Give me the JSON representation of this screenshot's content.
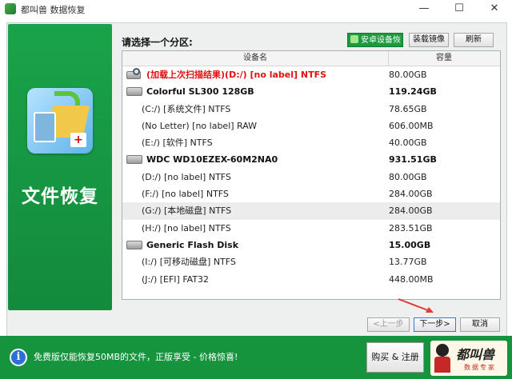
{
  "window": {
    "title": "都叫兽 数据恢复",
    "minimize": "—",
    "maximize": "☐",
    "close": "✕"
  },
  "left_panel": {
    "hero_text": "文件恢复"
  },
  "prompt": "请选择一个分区:",
  "toolbar": {
    "android": "安卓设备恢复",
    "mount": "装载镜像",
    "refresh": "刷新"
  },
  "list": {
    "headers": {
      "device": "设备名",
      "capacity": "容量"
    },
    "rows": [
      {
        "type": "scan",
        "name": "(加载上次扫描结果)(D:/) [no label] NTFS",
        "cap": "80.00GB"
      },
      {
        "type": "disk",
        "name": "Colorful SL300 128GB",
        "cap": "119.24GB"
      },
      {
        "type": "part",
        "name": "(C:/) [系统文件] NTFS",
        "cap": "78.65GB"
      },
      {
        "type": "part",
        "name": "(No Letter) [no label] RAW",
        "cap": "606.00MB"
      },
      {
        "type": "part",
        "name": "(E:/) [软件] NTFS",
        "cap": "40.00GB"
      },
      {
        "type": "disk",
        "name": "WDC WD10EZEX-60M2NA0",
        "cap": "931.51GB"
      },
      {
        "type": "part",
        "name": "(D:/) [no label] NTFS",
        "cap": "80.00GB"
      },
      {
        "type": "part",
        "name": "(F:/) [no label] NTFS",
        "cap": "284.00GB"
      },
      {
        "type": "part",
        "name": "(G:/) [本地磁盘] NTFS",
        "cap": "284.00GB",
        "selected": true
      },
      {
        "type": "part",
        "name": "(H:/) [no label] NTFS",
        "cap": "283.51GB"
      },
      {
        "type": "disk",
        "name": "Generic Flash Disk",
        "cap": "15.00GB"
      },
      {
        "type": "part",
        "name": "(I:/) [可移动磁盘] NTFS",
        "cap": "13.77GB"
      },
      {
        "type": "part",
        "name": "(J:/) [EFI] FAT32",
        "cap": "448.00MB"
      }
    ]
  },
  "nav": {
    "prev": "<上一步",
    "next": "下一步>",
    "cancel": "取消"
  },
  "bottom": {
    "info_icon": "i",
    "text": "免费版仅能恢复50MB的文件，正版享受 - 价格惊喜!",
    "buy": "购买 & 注册",
    "brand_name": "都叫兽",
    "brand_sub": "数据专家"
  },
  "colors": {
    "accent_green": "#15933d",
    "scan_red": "#e01010",
    "arrow_red": "#e53935"
  }
}
